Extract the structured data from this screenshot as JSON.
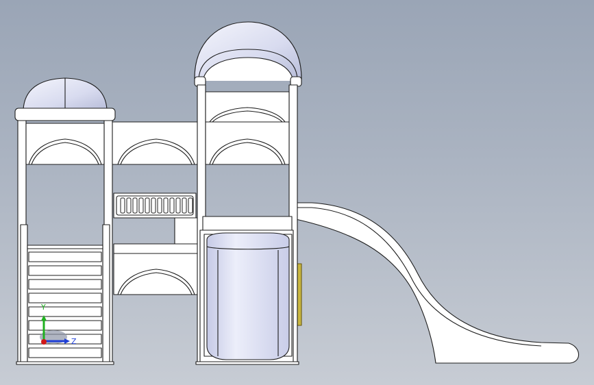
{
  "viewport": {
    "background_top": "#9aa5b6",
    "background_bottom": "#c7ccd4"
  },
  "model": {
    "part_fill": "#ffffff",
    "edge_color": "#1c1c1c",
    "dome_fill": "#e4e6f4",
    "slide_tube_fill": "#d9dcf0",
    "slide_accent": "#c8b640"
  },
  "triad": {
    "y_label": "Y",
    "z_label": "Z",
    "y_color": "#20b020",
    "z_color": "#1f3fd6",
    "x_color": "#d01818"
  }
}
